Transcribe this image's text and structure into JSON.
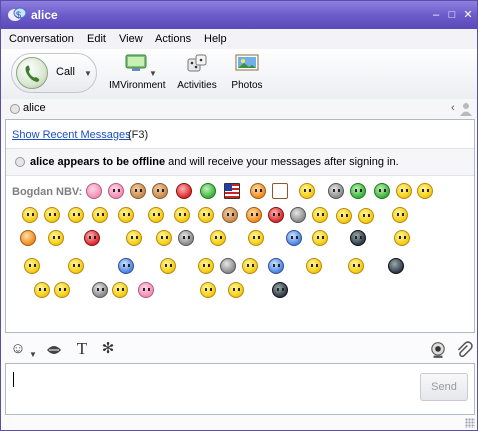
{
  "window": {
    "title": "alice",
    "controls": [
      "–",
      "□",
      "✕"
    ]
  },
  "menu": [
    "Conversation",
    "Edit",
    "View",
    "Actions",
    "Help"
  ],
  "toolbar": {
    "call_label": "Call",
    "tools": [
      {
        "label": "IMVironment",
        "icon": "imvironment-icon"
      },
      {
        "label": "Activities",
        "icon": "activities-icon"
      },
      {
        "label": "Photos",
        "icon": "photos-icon"
      }
    ]
  },
  "recipient": {
    "name": "alice",
    "status": "offline"
  },
  "conversation": {
    "history_link": "Show Recent Messages",
    "history_shortcut": "(F3)",
    "notice_bold": "alice appears to be offline",
    "notice_rest": " and will receive your messages after signing in.",
    "sender": "Bogdan NBV:",
    "emoticon_rows": 5
  },
  "input": {
    "value": "",
    "send_label": "Send"
  },
  "colors": {
    "titlebar": "#6a59c8",
    "link": "#1a4fc2",
    "sender": "#7f7f7f"
  }
}
